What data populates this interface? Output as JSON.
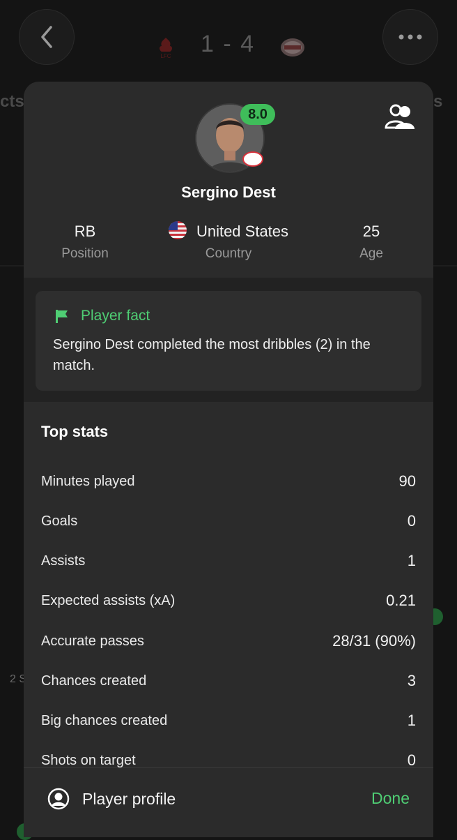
{
  "match": {
    "score": "1 - 4",
    "home_logo": "liverpool-logo",
    "away_logo": "psv-logo",
    "bg_left_text": "cts",
    "bg_right_text": "s",
    "bg_small_text": "2 S"
  },
  "player": {
    "name": "Sergino Dest",
    "rating": "8.0",
    "rating_color": "#3fbd5a",
    "club_badge": "psv-badge"
  },
  "info": {
    "position_value": "RB",
    "position_label": "Position",
    "country_value": "United States",
    "country_label": "Country",
    "age_value": "25",
    "age_label": "Age"
  },
  "fact": {
    "title": "Player fact",
    "text": "Sergino Dest completed the most dribbles (2) in the match."
  },
  "stats": {
    "title": "Top stats",
    "rows": [
      {
        "label": "Minutes played",
        "value": "90"
      },
      {
        "label": "Goals",
        "value": "0"
      },
      {
        "label": "Assists",
        "value": "1"
      },
      {
        "label": "Expected assists (xA)",
        "value": "0.21"
      },
      {
        "label": "Accurate passes",
        "value": "28/31 (90%)"
      },
      {
        "label": "Chances created",
        "value": "3"
      },
      {
        "label": "Big chances created",
        "value": "1"
      },
      {
        "label": "Shots on target",
        "value": "0"
      }
    ]
  },
  "footer": {
    "profile_label": "Player profile",
    "done_label": "Done"
  },
  "colors": {
    "accent": "#4fce74",
    "sheet_bg": "#2b2b2b"
  }
}
